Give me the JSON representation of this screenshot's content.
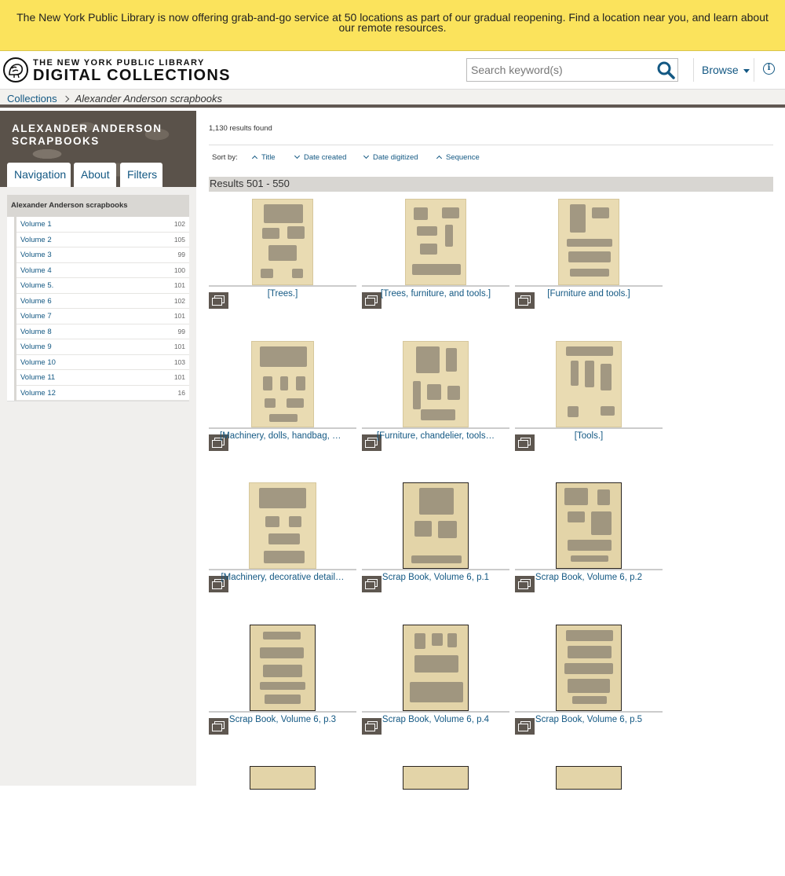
{
  "alert": {
    "text": "The New York Public Library is now offering grab-and-go service at 50 locations as part of our gradual reopening. Find a location near you, and learn about our remote resources."
  },
  "header": {
    "brand_top": "THE NEW YORK PUBLIC LIBRARY",
    "brand_main": "DIGITAL COLLECTIONS",
    "search_placeholder": "Search keyword(s)",
    "browse_label": "Browse"
  },
  "breadcrumb": {
    "root": "Collections",
    "current": "Alexander Anderson scrapbooks"
  },
  "sidebar": {
    "title": "ALEXANDER ANDERSON SCRAPBOOKS",
    "tabs": [
      "Navigation",
      "About",
      "Filters"
    ],
    "nav_heading": "Alexander Anderson scrapbooks",
    "volumes": [
      {
        "label": "Volume 1",
        "count": "102"
      },
      {
        "label": "Volume 2",
        "count": "105"
      },
      {
        "label": "Volume 3",
        "count": "99"
      },
      {
        "label": "Volume 4",
        "count": "100"
      },
      {
        "label": "Volume 5.",
        "count": "101"
      },
      {
        "label": "Volume 6",
        "count": "102"
      },
      {
        "label": "Volume 7",
        "count": "101"
      },
      {
        "label": "Volume 8",
        "count": "99"
      },
      {
        "label": "Volume 9",
        "count": "101"
      },
      {
        "label": "Volume 10",
        "count": "103"
      },
      {
        "label": "Volume 11",
        "count": "101"
      },
      {
        "label": "Volume 12",
        "count": "16"
      }
    ]
  },
  "main": {
    "result_count": "1,130 results found",
    "sort_label": "Sort by:",
    "sort_options": [
      {
        "label": "Title",
        "icon": "chevron-up-icon"
      },
      {
        "label": "Date created",
        "icon": "chevron-down-icon"
      },
      {
        "label": "Date digitized",
        "icon": "chevron-down-icon"
      },
      {
        "label": "Sequence",
        "icon": "chevron-up-icon"
      }
    ],
    "results_range": "Results 501 - 550",
    "items": [
      {
        "title": "[Trees.]"
      },
      {
        "title": "[Trees, furniture, and tools.]"
      },
      {
        "title": "[Furniture and tools.]"
      },
      {
        "title": "[Machinery, dolls, handbag, a…"
      },
      {
        "title": "[Furniture, chandelier, tools…"
      },
      {
        "title": "[Tools.]"
      },
      {
        "title": "[Machinery, decorative detail…"
      },
      {
        "title": "Scrap Book, Volume 6, p.1"
      },
      {
        "title": "Scrap Book, Volume 6, p.2"
      },
      {
        "title": "Scrap Book, Volume 6, p.3"
      },
      {
        "title": "Scrap Book, Volume 6, p.4"
      },
      {
        "title": "Scrap Book, Volume 6, p.5"
      }
    ]
  },
  "colors": {
    "alert_bg": "#fbe35c",
    "link": "#135883",
    "sidebar_bg": "#f0efed",
    "results_bar": "#d8d6d2"
  }
}
